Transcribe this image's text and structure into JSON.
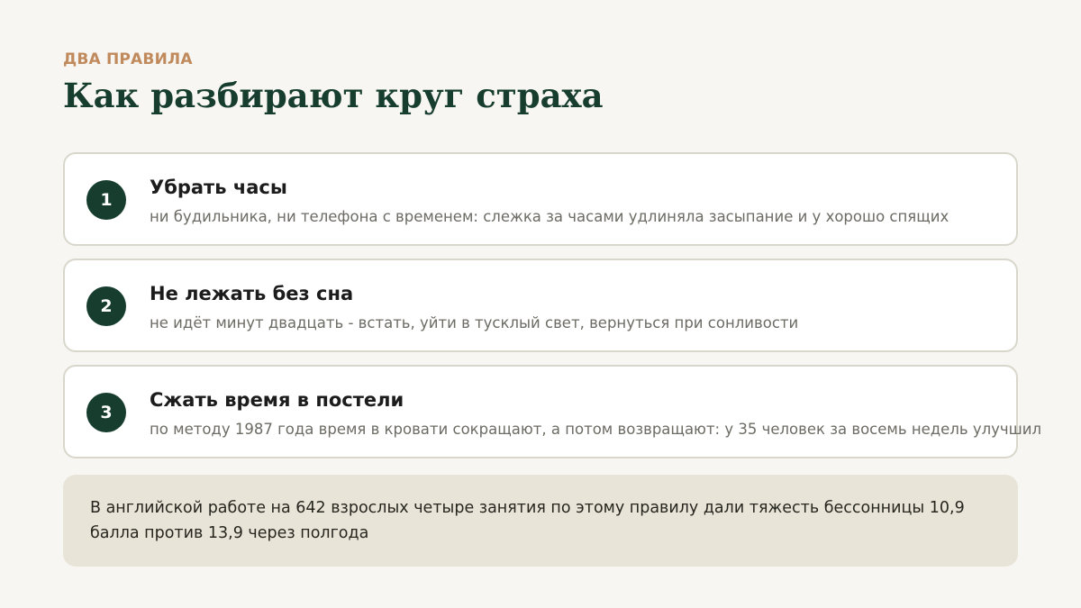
{
  "header": {
    "eyebrow": "ДВА ПРАВИЛА",
    "title": "Как разбирают круг страха"
  },
  "cards": [
    {
      "number": "1",
      "title": "Убрать часы",
      "description": "ни будильника, ни телефона с временем: слежка за часами удлиняла засыпание и у хорошо спящих"
    },
    {
      "number": "2",
      "title": "Не лежать без сна",
      "description": "не идёт минут двадцать - встать, уйти в тусклый свет, вернуться при сонливости"
    },
    {
      "number": "3",
      "title": "Сжать время в постели",
      "description": "по методу 1987 года время в кровати сокращают, а потом возвращают: у 35 человек за восемь недель улучшил"
    }
  ],
  "note": {
    "text": "В английской работе на 642 взрослых четыре занятия по этому правилу дали тяжесть бессонницы 10,9 балла против 13,9 через полгода"
  },
  "colors": {
    "background": "#f7f6f3",
    "accent": "#c08a5c",
    "primary": "#163d2e",
    "note_background": "#e9e4d8"
  }
}
